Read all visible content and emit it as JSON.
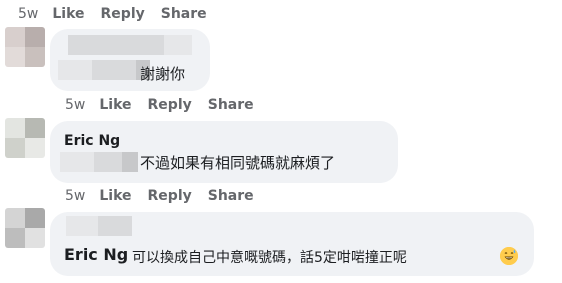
{
  "actions": {
    "time": "5w",
    "like": "Like",
    "reply": "Reply",
    "share": "Share"
  },
  "comments": [
    {
      "author": "",
      "text": "謝謝你"
    },
    {
      "author": "Eric Ng",
      "text": "不過如果有相同號碼就麻煩了"
    },
    {
      "author": "",
      "mention": "Eric Ng",
      "text": "可以換成自己中意嘅號碼，話5定咁啱撞正呢"
    }
  ],
  "icons": {
    "reaction_emoji": "grinning-sweat-emoji-icon"
  }
}
